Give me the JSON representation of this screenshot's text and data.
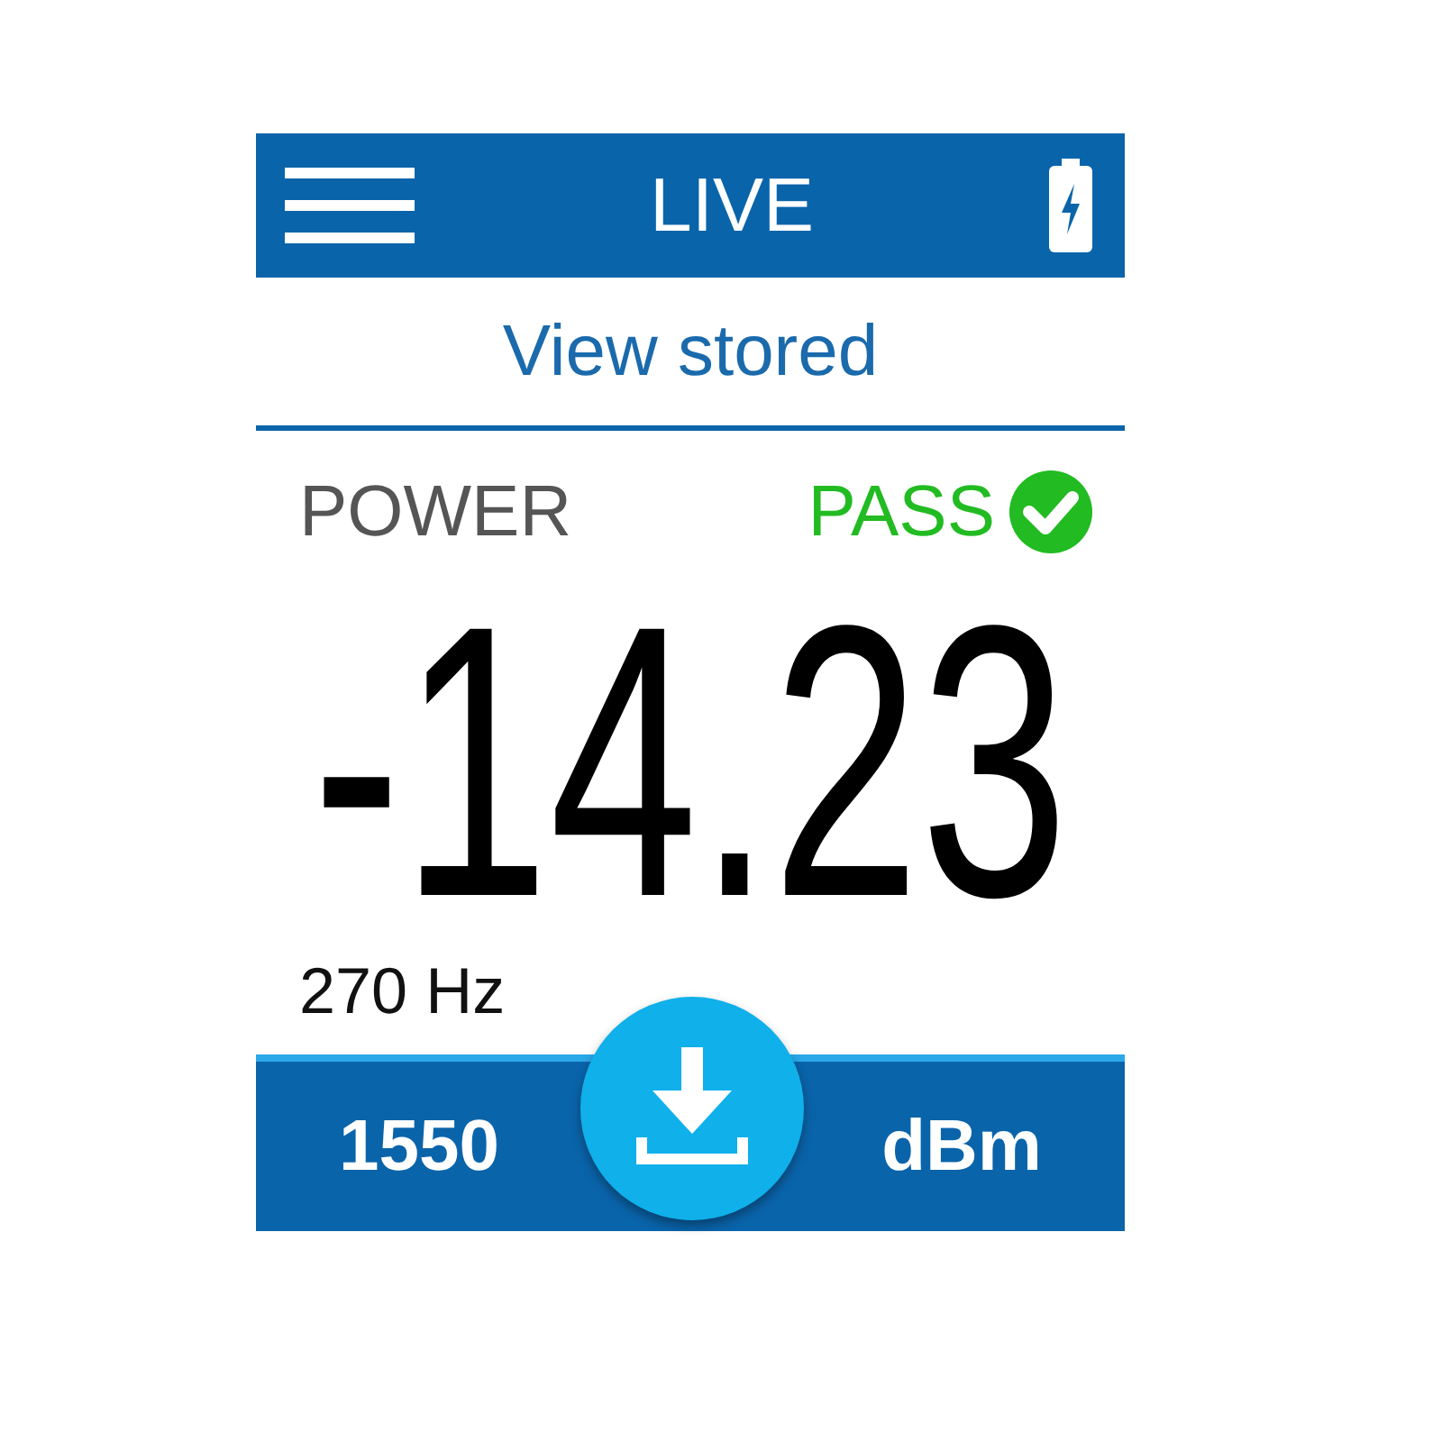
{
  "header": {
    "title": "LIVE"
  },
  "link": "View stored",
  "measurement": {
    "label": "POWER",
    "result": {
      "label": "PASS",
      "passed": true
    },
    "value": "-14.23",
    "frequency": "270 Hz"
  },
  "footer": {
    "wavelength": "1550",
    "unit": "dBm"
  }
}
